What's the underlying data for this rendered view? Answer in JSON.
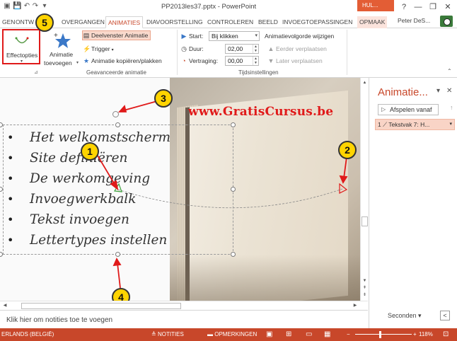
{
  "window": {
    "title": "PP2013les37.pptx - PowerPoint",
    "context_tab": "HUL...",
    "min": "—",
    "restore": "❐",
    "close": "✕"
  },
  "tabs": [
    "GEN",
    "ONTW",
    "OVERGANGEN",
    "ANIMATIES",
    "DIAVOORSTELLING",
    "CONTROLEREN",
    "BEELD",
    "INVOEGTOEPASSINGEN",
    "OPMAAK"
  ],
  "active_tab": "ANIMATIES",
  "user": "Peter DeS...",
  "ribbon": {
    "effect_options": "Effectopties",
    "add_animation_1": "Animatie",
    "add_animation_2": "toevoegen",
    "animation_pane": "Deelvenster Animatie",
    "trigger": "Trigger",
    "copy_animation": "Animatie kopiëren/plakken",
    "group_advanced": "Geavanceerde animatie",
    "start_label": "Start:",
    "start_value": "Bij klikken",
    "duration_label": "Duur:",
    "duration_value": "02,00",
    "delay_label": "Vertraging:",
    "delay_value": "00,00",
    "reorder_title": "Animatievolgorde wijzigen",
    "move_earlier": "Eerder verplaatsen",
    "move_later": "Later verplaatsen",
    "group_timing": "Tijdsinstellingen"
  },
  "slide": {
    "watermark": "www.GratisCursus.be",
    "bullets": [
      "Het welkomstscherm",
      "Site definiëren",
      "De werkomgeving",
      "Invoegwerkbalk",
      "Tekst invoegen",
      "Lettertypes instellen"
    ],
    "callouts": [
      "1",
      "2",
      "3",
      "4",
      "5"
    ]
  },
  "notes_placeholder": "Klik hier om notities toe te voegen",
  "anim_pane": {
    "title": "Animatie...",
    "play_from": "Afspelen vanaf",
    "item": "1 ⟋ Tekstvak 7: H...",
    "seconds": "Seconden"
  },
  "status": {
    "language": "ERLANDS (BELGIË)",
    "notes": "NOTITIES",
    "comments": "OPMERKINGEN",
    "zoom": "118%"
  },
  "colors": {
    "accent": "#c8472a",
    "callout": "#ffd400",
    "arrow": "#e01a1a"
  }
}
